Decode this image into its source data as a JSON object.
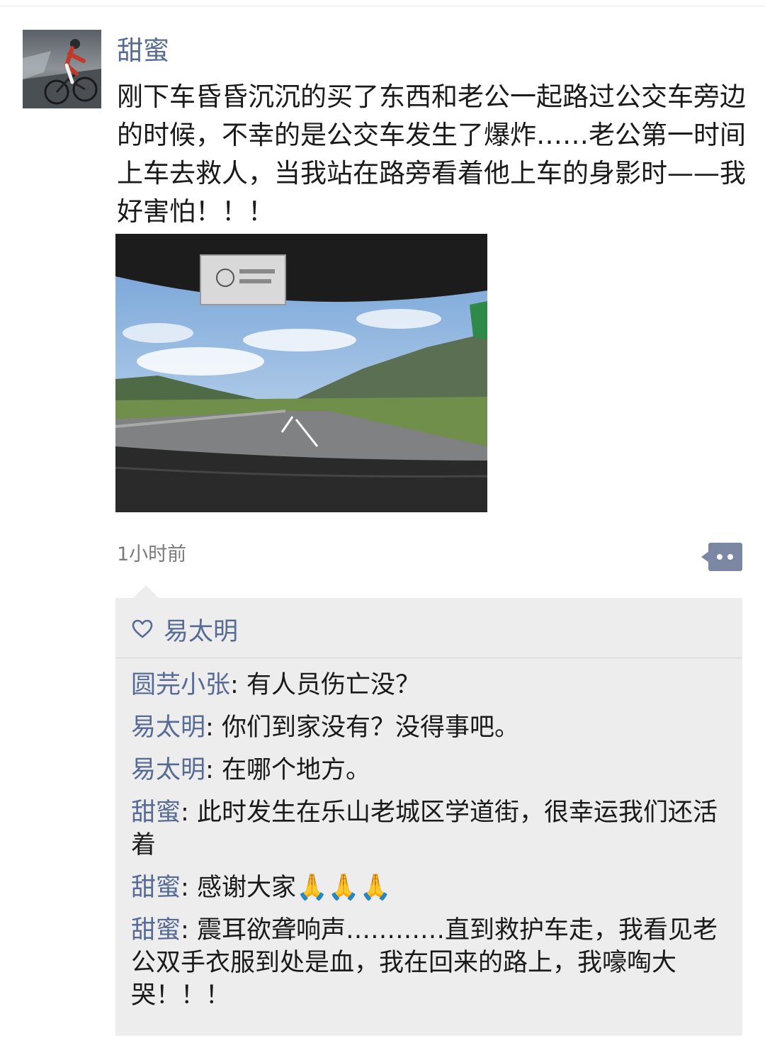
{
  "post": {
    "author": "甜蜜",
    "text": "刚下车昏昏沉沉的买了东西和老公一起路过公交车旁边的时候，不幸的是公交车发生了爆炸……老公第一时间上车去救人，当我站在路旁看着他上车的身影时——我好害怕！！！",
    "timestamp": "1小时前",
    "avatar_icon": "cyclist-avatar",
    "photo_icon": "highway-windshield-photo"
  },
  "likes": {
    "icon": "heart-outline-icon",
    "names": "易太明"
  },
  "comments": [
    {
      "name": "圆芫小张",
      "text": "有人员伤亡没？"
    },
    {
      "name": "易太明",
      "text": "你们到家没有？没得事吧。"
    },
    {
      "name": "易太明",
      "text": "在哪个地方。"
    },
    {
      "name": "甜蜜",
      "text": "此时发生在乐山老城区学道街，很幸运我们还活着"
    },
    {
      "name": "甜蜜",
      "text": "感谢大家",
      "emoji": "🙏🙏🙏"
    },
    {
      "name": "甜蜜",
      "text": "震耳欲聋响声…………直到救护车走，我看见老公双手衣服到处是血，我在回来的路上，我嚎啕大哭！！！"
    }
  ],
  "colors": {
    "name_link": "#576b95",
    "panel_bg": "#ededed",
    "more_button": "#7c88a3"
  }
}
